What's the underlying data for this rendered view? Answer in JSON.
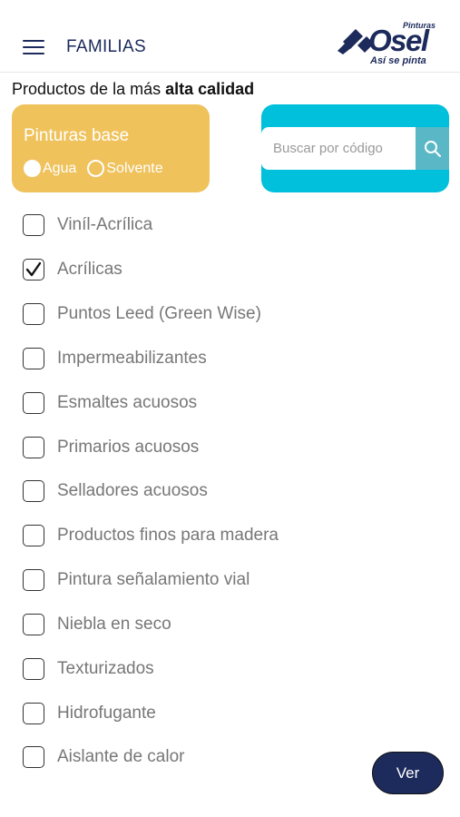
{
  "header": {
    "title": "FAMILIAS",
    "logo": {
      "brand": "Osel",
      "small": "Pinturas",
      "tagline": "Así se pinta"
    }
  },
  "subtitle": {
    "prefix": "Productos de la más ",
    "bold": "alta calidad"
  },
  "base_filter": {
    "title": "Pinturas base",
    "options": [
      {
        "label": "Agua",
        "selected": true
      },
      {
        "label": "Solvente",
        "selected": false
      }
    ]
  },
  "search": {
    "placeholder": "Buscar por código",
    "value": ""
  },
  "families": [
    {
      "label": "Viníl-Acrílica",
      "checked": false
    },
    {
      "label": "Acrílicas",
      "checked": true
    },
    {
      "label": "Puntos Leed (Green Wise)",
      "checked": false
    },
    {
      "label": "Impermeabilizantes",
      "checked": false
    },
    {
      "label": "Esmaltes acuosos",
      "checked": false
    },
    {
      "label": "Primarios acuosos",
      "checked": false
    },
    {
      "label": "Selladores acuosos",
      "checked": false
    },
    {
      "label": "Productos finos para madera",
      "checked": false
    },
    {
      "label": "Pintura señalamiento vial",
      "checked": false
    },
    {
      "label": "Niebla en seco",
      "checked": false
    },
    {
      "label": "Texturizados",
      "checked": false
    },
    {
      "label": "Hidrofugante",
      "checked": false
    },
    {
      "label": "Aislante de calor",
      "checked": false
    }
  ],
  "actions": {
    "ver_label": "Ver"
  },
  "colors": {
    "brand_navy": "#1c2a5c",
    "base_card": "#efc25c",
    "search_card": "#00c0db",
    "search_button": "#5ab7c6"
  },
  "icons": {
    "menu": "hamburger-icon",
    "search": "search-icon",
    "check": "checkmark-icon"
  }
}
